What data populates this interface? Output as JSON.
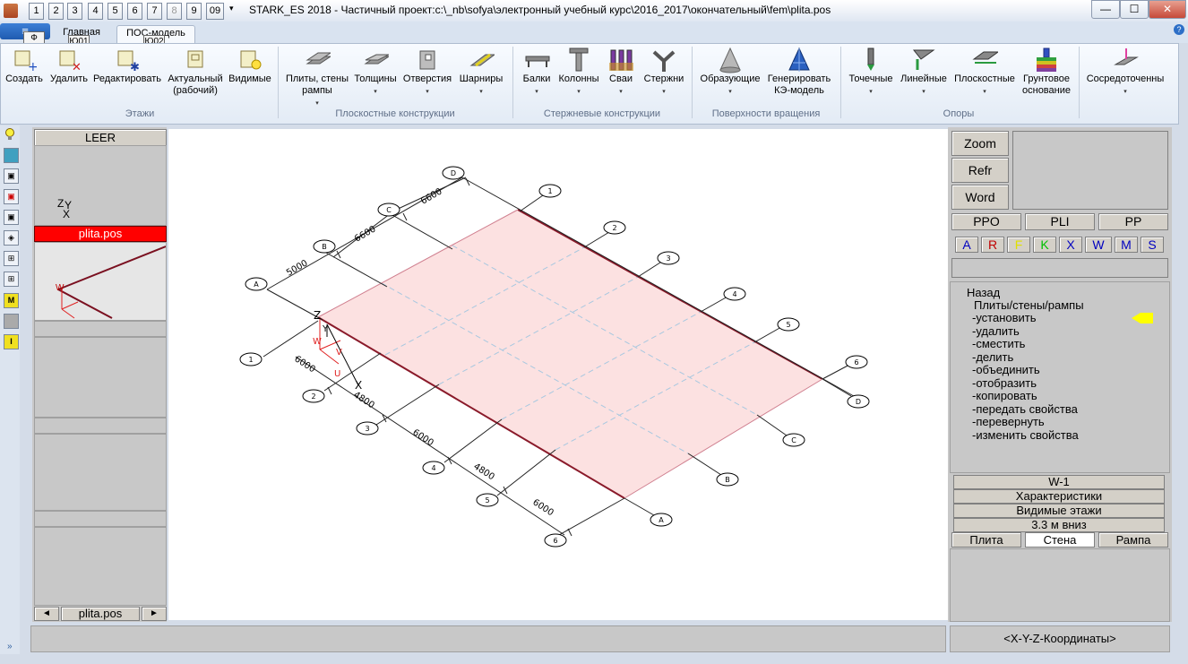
{
  "window": {
    "title": "STARK_ES 2018 - Частичный проект:c:\\_nb\\sofya\\электронный учебный курс\\2016_2017\\окончательный\\fem\\plita.pos",
    "quick_access": [
      "1",
      "2",
      "3",
      "4",
      "5",
      "6",
      "7",
      "8",
      "9",
      "09"
    ],
    "minimize": "—",
    "maximize": "☐",
    "close": "✕"
  },
  "ribbon": {
    "app_button": "≡",
    "app_keytip": "Ф",
    "tabs": [
      {
        "label": "Главная",
        "keytip": "Ю01"
      },
      {
        "label": "ПОС-модель",
        "keytip": "Ю02"
      }
    ],
    "groups": [
      {
        "label": "Этажи",
        "buttons": [
          "Создать",
          "Удалить",
          "Редактировать",
          "Актуальный (рабочий)",
          "Видимые"
        ]
      },
      {
        "label": "Плоскостные конструкции",
        "buttons": [
          "Плиты, стены рампы",
          "Толщины",
          "Отверстия",
          "Шарниры"
        ]
      },
      {
        "label": "Стержневые конструкции",
        "buttons": [
          "Балки",
          "Колонны",
          "Сваи",
          "Стержни"
        ]
      },
      {
        "label": "Поверхности вращения",
        "buttons": [
          "Образующие",
          "Генерировать КЭ-модель"
        ]
      },
      {
        "label": "Опоры",
        "buttons": [
          "Точечные",
          "Линейные",
          "Плоскостные",
          "Грунтовое основание",
          "Сосредоточенны"
        ]
      }
    ]
  },
  "left_panel": {
    "header": "LEER",
    "axis_labels": [
      "Z",
      "Y",
      "X"
    ],
    "active_file": "plita.pos",
    "preview_label": "W",
    "nav_file": "plita.pos",
    "nav_prev": "◄",
    "nav_next": "►"
  },
  "canvas": {
    "axes_tags_left": [
      "1",
      "2",
      "3",
      "4",
      "5",
      "6"
    ],
    "axes_tags_right_numbers": [
      "1",
      "2",
      "3",
      "4",
      "5",
      "6"
    ],
    "axes_tags_letters": [
      "A",
      "B",
      "C",
      "D"
    ],
    "dims_top": [
      "5000",
      "6600",
      "6600"
    ],
    "dims_bottom": [
      "6000",
      "4800",
      "6000",
      "4800",
      "6000"
    ],
    "coord_labels": {
      "z": "Z",
      "y": "Y",
      "x": "X",
      "w": "W",
      "v": "V",
      "u": "U"
    }
  },
  "right_panel": {
    "buttons": [
      "Zoom",
      "Refr",
      "Word"
    ],
    "row2": [
      "PPO",
      "PLI",
      "PP"
    ],
    "filters": [
      {
        "label": "A",
        "color": "#0000c0"
      },
      {
        "label": "R",
        "color": "#c00000"
      },
      {
        "label": "F",
        "color": "#e0e000"
      },
      {
        "label": "K",
        "color": "#00c000"
      },
      {
        "label": "X",
        "color": "#0000c0"
      },
      {
        "label": "W",
        "color": "#0000c0"
      },
      {
        "label": "M",
        "color": "#0000c0"
      },
      {
        "label": "S",
        "color": "#0000c0"
      }
    ],
    "menu_back": "Назад",
    "menu_title": "Плиты/стены/рампы",
    "menu_items": [
      "-установить",
      "-удалить",
      "-сместить",
      "-делить",
      "-объединить",
      "-отобразить",
      "-копировать",
      "-передать свойства",
      "-перевернуть",
      "-изменить свойства"
    ],
    "bars": [
      "W-1",
      "Характеристики",
      "Видимые этажи",
      "3.3 м вниз"
    ],
    "type_buttons": [
      "Плита",
      "Стена",
      "Рампа"
    ],
    "pointer_color": "#ffff00"
  },
  "status": {
    "coords": "<X-Y-Z-Координаты>"
  }
}
